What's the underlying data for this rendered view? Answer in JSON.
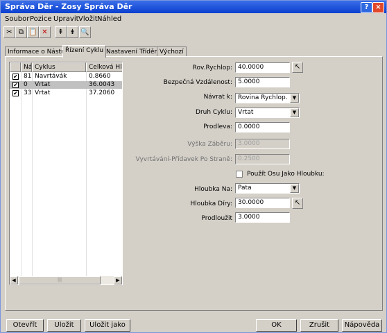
{
  "window": {
    "title": "Správa Děr - Zosy Správa Děr",
    "help_label": "?",
    "close_label": "×"
  },
  "menu": [
    "Soubor",
    "Pozice",
    "Upravit",
    "Vložit",
    "Náhled"
  ],
  "toolbar": {
    "icons": [
      "cut-icon",
      "copy-icon",
      "paste-icon",
      "delete-icon",
      "move-up-icon",
      "move-down-icon",
      "preview-icon"
    ],
    "glyphs": [
      "✂",
      "⧉",
      "📋",
      "✕",
      "⇞",
      "⇟",
      "🔍"
    ]
  },
  "tabs": [
    "Informace o Nástroji",
    "Řízení Cyklu",
    "Nastavení Třídění",
    "Výchozí"
  ],
  "active_tab": 1,
  "list": {
    "columns": [
      "Ná...",
      "Cyklus",
      "Celková Hlo"
    ],
    "rows": [
      {
        "checked": true,
        "num": "81",
        "cycle": "Navrtávák",
        "depth": "0.8660",
        "selected": false
      },
      {
        "checked": true,
        "num": "0",
        "cycle": "Vrtat",
        "depth": "36.0043",
        "selected": true
      },
      {
        "checked": true,
        "num": "33",
        "cycle": "Vrtat",
        "depth": "37.2060",
        "selected": false
      }
    ],
    "scroll_left": "◀",
    "scroll_right": "▶",
    "scroll_grip": "|||",
    "check_mark": "✔"
  },
  "form": {
    "rapid_label": "Rov.Rychlop:",
    "rapid_value": "40.0000",
    "safe_label": "Bezpečná Vzdálenost:",
    "safe_value": "5.0000",
    "return_label": "Návrat k:",
    "return_value": "Rovina Rychlop.",
    "cycle_label": "Druh Cyklu:",
    "cycle_value": "Vrtat",
    "dwell_label": "Prodleva:",
    "dwell_value": "0.0000",
    "peck_label": "Výška Záběru:",
    "peck_value": "3.0000",
    "chip_label": "Vyvrtávání-Přídavek Po Straně:",
    "chip_value": "0.2500",
    "use_axis_label": "Použít Osu Jako Hloubku:",
    "depth_to_label": "Hloubka Na:",
    "depth_to_value": "Pata",
    "hole_depth_label": "Hloubka Díry:",
    "hole_depth_value": "30.0000",
    "extend_label": "Prodloužit",
    "extend_value": "3.0000",
    "dropdown_glyph": "▼",
    "pick_glyph": "↖"
  },
  "buttons": {
    "open": "Otevřít",
    "save": "Uložit",
    "save_as": "Uložit jako",
    "ok": "OK",
    "cancel": "Zrušit",
    "help": "Nápověda"
  }
}
